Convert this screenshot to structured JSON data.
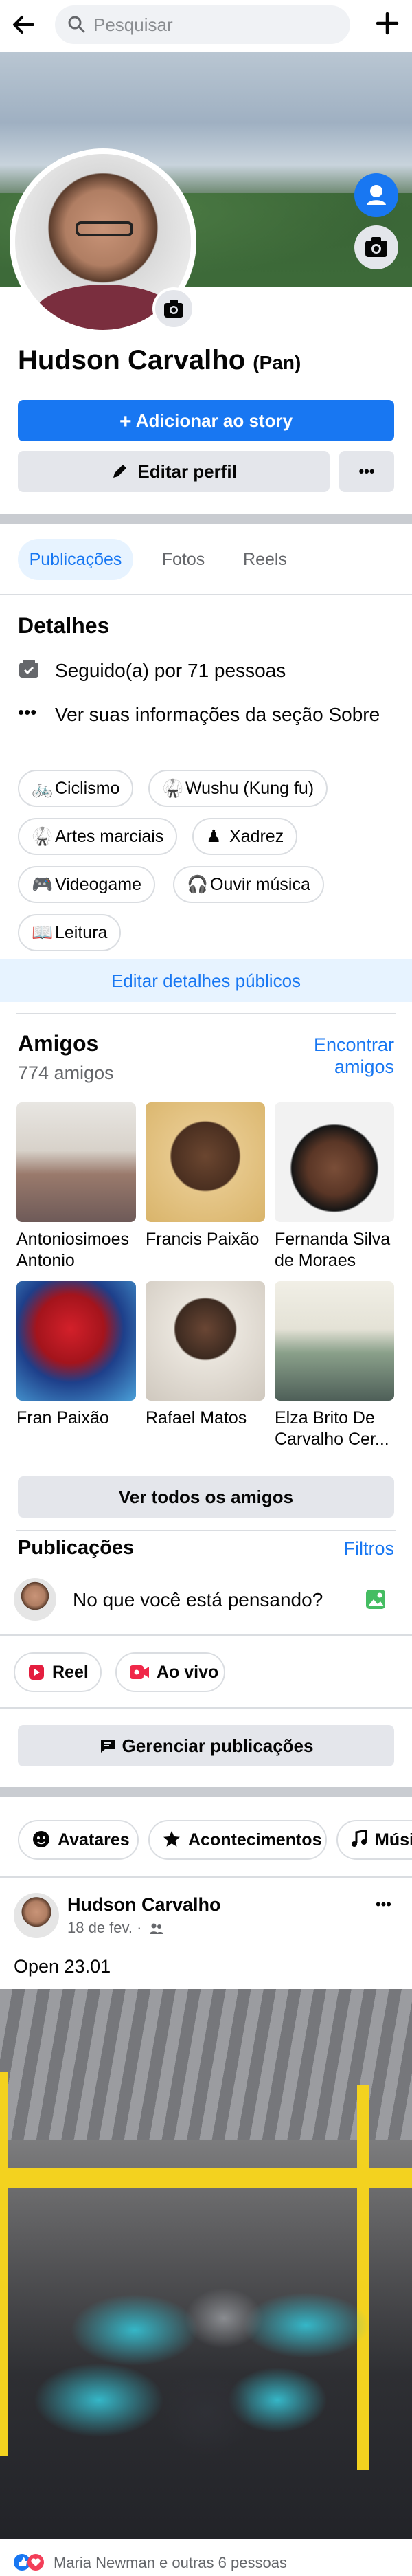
{
  "search": {
    "placeholder": "Pesquisar"
  },
  "profile": {
    "name": "Hudson Carvalho",
    "nickname": "(Pan)",
    "add_story_label": "Adicionar ao story",
    "edit_profile_label": "Editar perfil",
    "more_label": "•••"
  },
  "tabs": [
    {
      "label": "Publicações",
      "active": true
    },
    {
      "label": "Fotos",
      "active": false
    },
    {
      "label": "Reels",
      "active": false
    }
  ],
  "details": {
    "title": "Detalhes",
    "followed": "Seguido(a) por 71 pessoas",
    "about": "Ver suas informações da seção Sobre",
    "interests": [
      {
        "label": "Ciclismo",
        "icon": "bicycle-icon"
      },
      {
        "label": "Wushu (Kung fu)",
        "icon": "martial-arts-icon"
      },
      {
        "label": "Artes marciais",
        "icon": "martial-arts-icon"
      },
      {
        "label": "Xadrez",
        "icon": "chess-icon"
      },
      {
        "label": "Videogame",
        "icon": "gamepad-icon"
      },
      {
        "label": "Ouvir música",
        "icon": "headphones-icon"
      },
      {
        "label": "Leitura",
        "icon": "book-icon"
      }
    ],
    "edit_public_label": "Editar detalhes públicos"
  },
  "friends": {
    "title": "Amigos",
    "count": "774 amigos",
    "find_label_1": "Encontrar",
    "find_label_2": "amigos",
    "list": [
      {
        "name": "Antoniosimoes Antonio"
      },
      {
        "name": "Francis Paixão"
      },
      {
        "name": "Fernanda Silva de Moraes"
      },
      {
        "name": "Fran Paixão"
      },
      {
        "name": "Rafael Matos"
      },
      {
        "name": "Elza Brito De Carvalho Cer..."
      }
    ],
    "see_all_label": "Ver todos os amigos"
  },
  "posts": {
    "title": "Publicações",
    "filters_label": "Filtros",
    "composer_placeholder": "No que você está pensando?",
    "reel_label": "Reel",
    "live_label": "Ao vivo",
    "manage_label": "Gerenciar publicações",
    "highlight_pills": [
      "Avatares",
      "Acontecimentos",
      "Músi"
    ]
  },
  "post": {
    "author": "Hudson Carvalho",
    "date": "18 de fev. ·",
    "text": "Open 23.01",
    "reactions": "Maria Newman e outras 6 pessoas",
    "more_label": "•••"
  },
  "colors": {
    "accent": "#1877f2",
    "light_accent": "#e7f3ff",
    "grey_button": "#e4e6eb",
    "text_secondary": "#65676b",
    "reel_red": "#e41e3f",
    "live_red": "#f02849",
    "photo_green": "#45bd62"
  }
}
